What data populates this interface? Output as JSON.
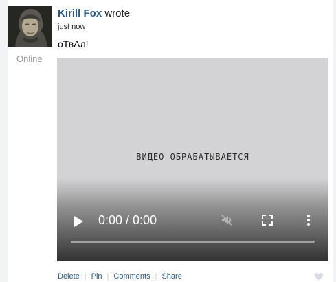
{
  "post": {
    "author": "Kirill Fox",
    "wrote": "wrote",
    "timestamp": "just now",
    "status": "Online",
    "text": "оТвАл!"
  },
  "video": {
    "processing_text": "ВИДЕО ОБРАБАТЫВАЕТСЯ",
    "time": "0:00 / 0:00",
    "progress": 0
  },
  "actions": {
    "delete": "Delete",
    "pin": "Pin",
    "comments": "Comments",
    "share": "Share"
  },
  "icons": {
    "avatar": "profile-photo",
    "play": "play-icon",
    "volume": "volume-icon",
    "fullscreen": "fullscreen-icon",
    "more": "more-options-icon",
    "like": "heart-icon"
  },
  "colors": {
    "link": "#2a5885",
    "muted": "#999999",
    "video_bg": "#d3d3d5"
  }
}
